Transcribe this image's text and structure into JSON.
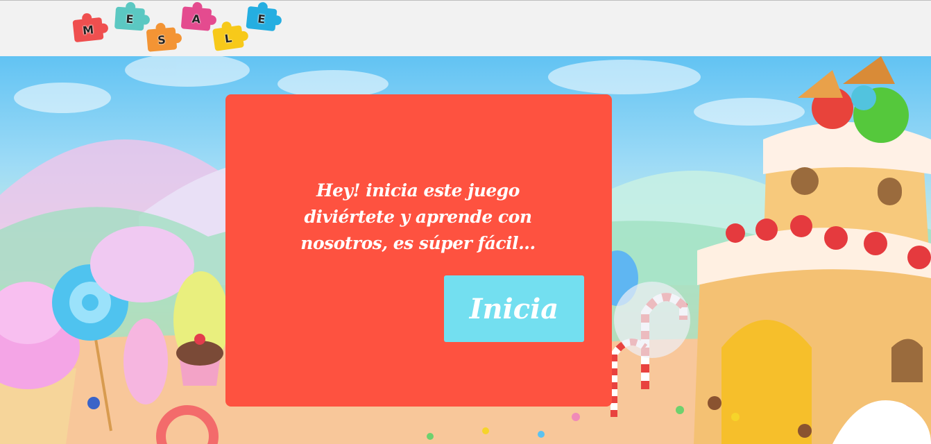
{
  "logo": {
    "letters": [
      {
        "char": "M",
        "color": "#ef4f4f"
      },
      {
        "char": "E",
        "color": "#5bc8c2"
      },
      {
        "char": "S",
        "color": "#f39434"
      },
      {
        "char": "A",
        "color": "#e44b8f"
      },
      {
        "char": "L",
        "color": "#f7c91a"
      },
      {
        "char": "E",
        "color": "#25aee1"
      }
    ]
  },
  "modal": {
    "message": "Hey! inicia este juego diviértete y aprende con nosotros, es súper fácil...",
    "button_label": "Inicia",
    "colors": {
      "panel": "#fe5240",
      "button": "#73dff0"
    }
  }
}
